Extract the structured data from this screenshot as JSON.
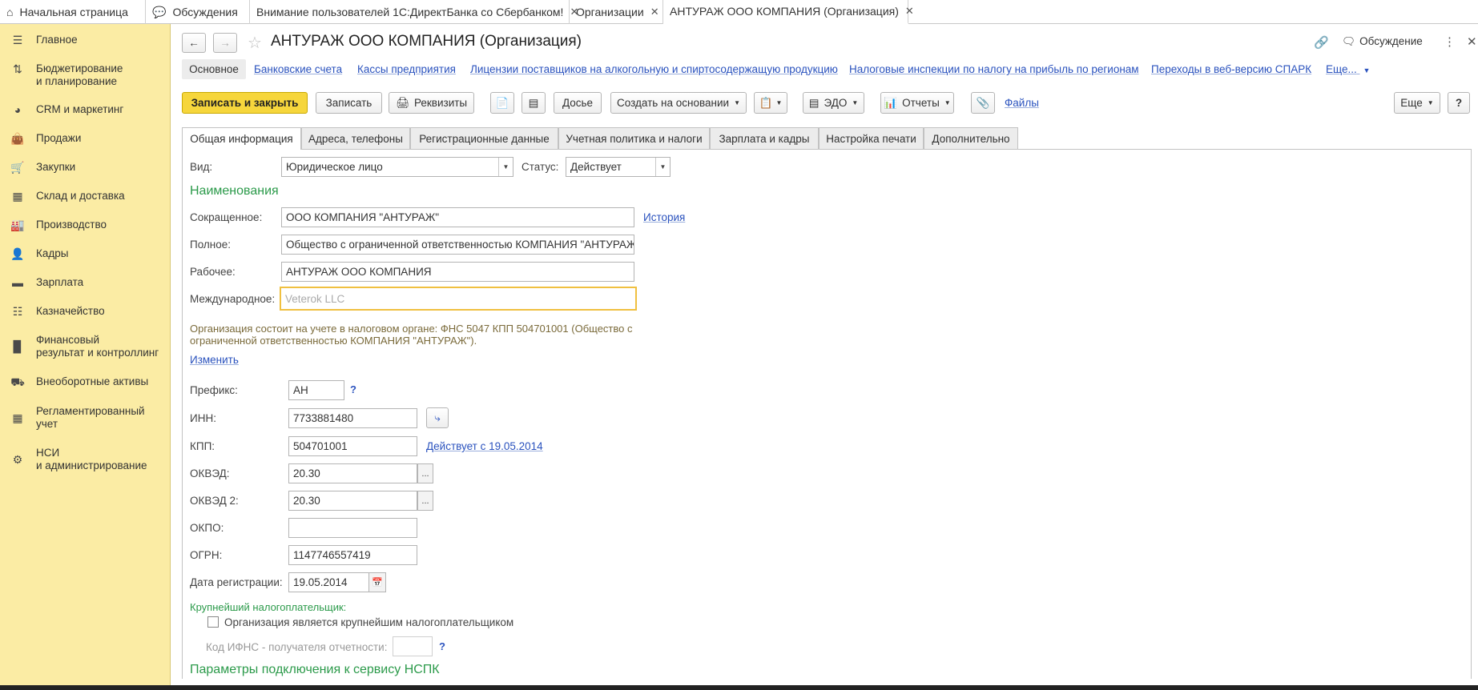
{
  "top_tabs": [
    {
      "label": "Начальная страница"
    },
    {
      "label": "Обсуждения"
    },
    {
      "label": "Внимание пользователей 1С:ДиректБанка со Сбербанком!"
    },
    {
      "label": "Организации"
    },
    {
      "label": "АНТУРАЖ ООО КОМПАНИЯ (Организация)"
    }
  ],
  "sidebar": {
    "items": [
      {
        "label": "Главное"
      },
      {
        "label": "Бюджетирование\nи планирование"
      },
      {
        "label": "CRM и маркетинг"
      },
      {
        "label": "Продажи"
      },
      {
        "label": "Закупки"
      },
      {
        "label": "Склад и доставка"
      },
      {
        "label": "Производство"
      },
      {
        "label": "Кадры"
      },
      {
        "label": "Зарплата"
      },
      {
        "label": "Казначейство"
      },
      {
        "label": "Финансовый\nрезультат и контроллинг"
      },
      {
        "label": "Внеоборотные активы"
      },
      {
        "label": "Регламентированный\nучет"
      },
      {
        "label": "НСИ\nи администрирование"
      }
    ]
  },
  "header": {
    "title": "АНТУРАЖ ООО КОМПАНИЯ (Организация)",
    "discussion": "Обсуждение"
  },
  "nav_links": [
    "Основное",
    "Банковские счета",
    "Кассы предприятия",
    "Лицензии поставщиков на алкогольную и спиртосодержащую продукцию",
    "Налоговые инспекции по налогу на прибыль по регионам",
    "Переходы в веб-версию СПАРК",
    "Еще..."
  ],
  "toolbar": {
    "save_close": "Записать и закрыть",
    "save": "Записать",
    "requisites": "Реквизиты",
    "dossier": "Досье",
    "create_based": "Создать на основании",
    "edo": "ЭДО",
    "reports": "Отчеты",
    "files": "Файлы",
    "more": "Еще",
    "help": "?"
  },
  "form_tabs": [
    "Общая информация",
    "Адреса, телефоны",
    "Регистрационные данные",
    "Учетная политика и налоги",
    "Зарплата и кадры",
    "Настройка печати",
    "Дополнительно"
  ],
  "form": {
    "vid_label": "Вид:",
    "vid_value": "Юридическое лицо",
    "status_label": "Статус:",
    "status_value": "Действует",
    "names_section": "Наименования",
    "short_label": "Сокращенное:",
    "short_value": "ООО КОМПАНИЯ \"АНТУРАЖ\"",
    "history_link": "История",
    "full_label": "Полное:",
    "full_value": "Общество с ограниченной ответственностью КОМПАНИЯ \"АНТУРАЖ\"",
    "work_label": "Рабочее:",
    "work_value": "АНТУРАЖ ООО КОМПАНИЯ",
    "intl_label": "Международное:",
    "intl_placeholder": "Veterok LLC",
    "tax_note": "Организация состоит на учете в налоговом органе: ФНС 5047 КПП 504701001 (Общество с\nограниченной ответственностью КОМПАНИЯ \"АНТУРАЖ\").",
    "change_link": "Изменить",
    "prefix_label": "Префикс:",
    "prefix_value": "АН",
    "help_q": "?",
    "inn_label": "ИНН:",
    "inn_value": "7733881480",
    "kpp_label": "КПП:",
    "kpp_value": "504701001",
    "kpp_link": "Действует с 19.05.2014",
    "okved_label": "ОКВЭД:",
    "okved_value": "20.30",
    "okved2_label": "ОКВЭД 2:",
    "okved2_value": "20.30",
    "okpo_label": "ОКПО:",
    "okpo_value": "",
    "ogrn_label": "ОГРН:",
    "ogrn_value": "1147746557419",
    "regdate_label": "Дата регистрации:",
    "regdate_value": "19.05.2014",
    "largest_section": "Крупнейший налогоплательщик:",
    "largest_checkbox": "Организация является крупнейшим налогоплательщиком",
    "ifns_label": "Код ИФНС - получателя отчетности:",
    "nspk_section": "Параметры подключения к сервису НСПК"
  }
}
